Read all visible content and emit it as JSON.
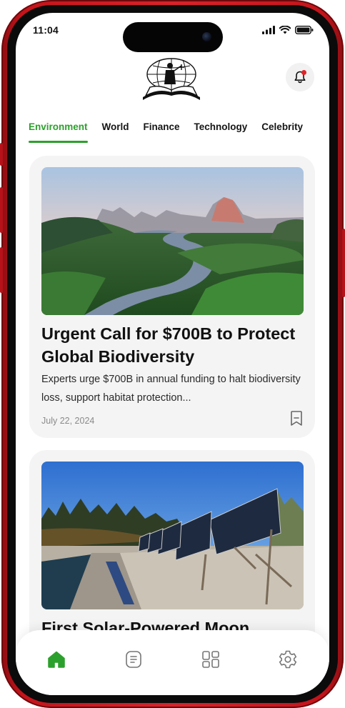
{
  "status": {
    "time": "11:04"
  },
  "tabs": [
    {
      "label": "Environment",
      "active": true
    },
    {
      "label": "World"
    },
    {
      "label": "Finance"
    },
    {
      "label": "Technology"
    },
    {
      "label": "Celebrity"
    }
  ],
  "articles": [
    {
      "title": "Urgent Call for $700B to Protect Global Biodiversity",
      "description": "Experts urge $700B in annual funding to halt biodiversity loss, support habitat protection...",
      "date": "July 22, 2024"
    },
    {
      "title": "First Solar-Powered Moon"
    }
  ],
  "nav": [
    "home-icon",
    "article-list-icon",
    "categories-icon",
    "settings-icon"
  ],
  "colors": {
    "accent": "#2ca02c",
    "frame": "#d8232a",
    "notification": "#e0242a"
  }
}
